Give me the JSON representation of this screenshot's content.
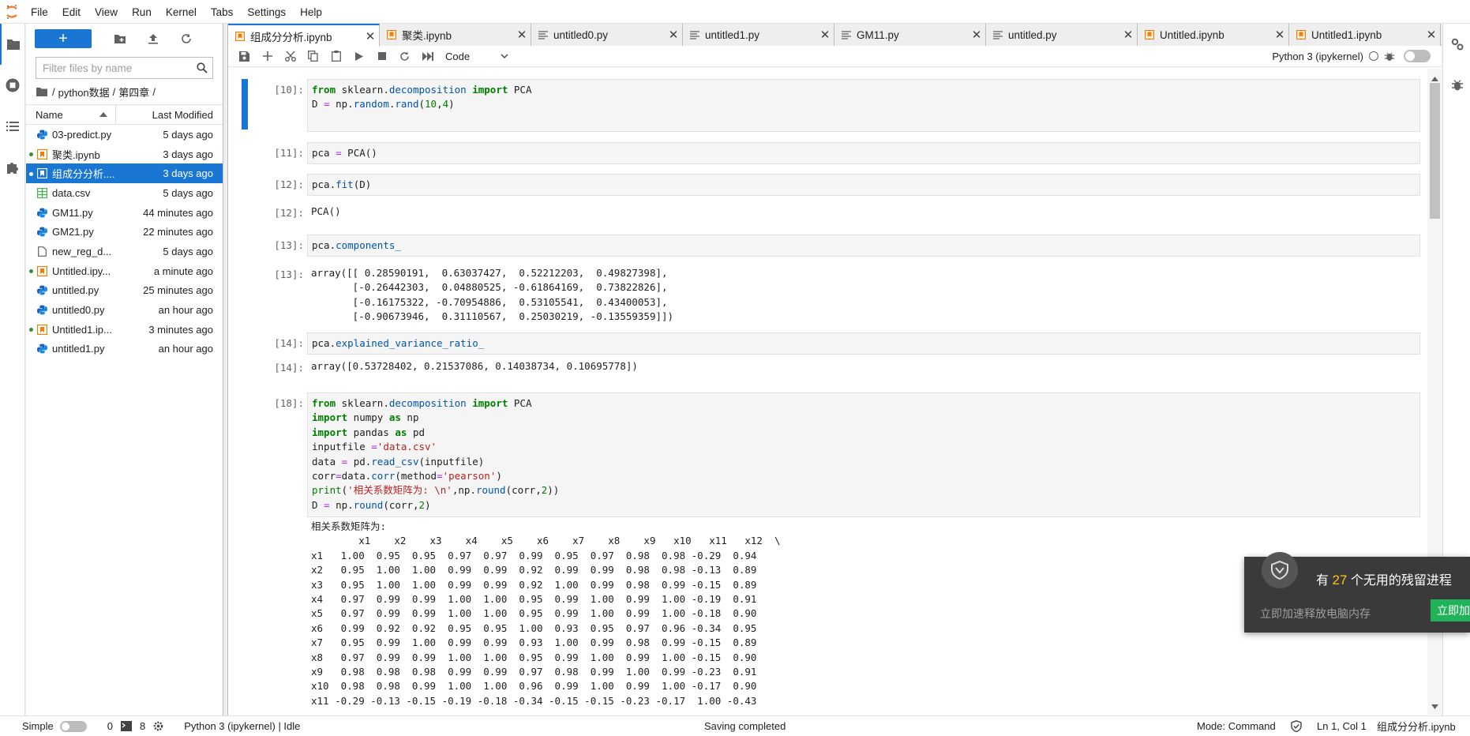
{
  "menubar": {
    "items": [
      "File",
      "Edit",
      "View",
      "Run",
      "Kernel",
      "Tabs",
      "Settings",
      "Help"
    ]
  },
  "filebrowser": {
    "filter_placeholder": "Filter files by name",
    "breadcrumb": [
      "/",
      "python数据",
      "/",
      "第四章",
      "/"
    ],
    "col_name": "Name",
    "col_modified": "Last Modified",
    "files": [
      {
        "name": "03-predict.py",
        "modified": "5 days ago",
        "type": "python",
        "running": false,
        "selected": false
      },
      {
        "name": "聚类.ipynb",
        "modified": "3 days ago",
        "type": "notebook",
        "running": true,
        "selected": false
      },
      {
        "name": "组成分分析....",
        "modified": "3 days ago",
        "type": "notebook",
        "running": true,
        "selected": true
      },
      {
        "name": "data.csv",
        "modified": "5 days ago",
        "type": "csv",
        "running": false,
        "selected": false
      },
      {
        "name": "GM11.py",
        "modified": "44 minutes ago",
        "type": "python",
        "running": false,
        "selected": false
      },
      {
        "name": "GM21.py",
        "modified": "22 minutes ago",
        "type": "python",
        "running": false,
        "selected": false
      },
      {
        "name": "new_reg_d...",
        "modified": "5 days ago",
        "type": "file",
        "running": false,
        "selected": false
      },
      {
        "name": "Untitled.ipy...",
        "modified": "a minute ago",
        "type": "notebook",
        "running": true,
        "selected": false
      },
      {
        "name": "untitled.py",
        "modified": "25 minutes ago",
        "type": "python",
        "running": false,
        "selected": false
      },
      {
        "name": "untitled0.py",
        "modified": "an hour ago",
        "type": "python",
        "running": false,
        "selected": false
      },
      {
        "name": "Untitled1.ip...",
        "modified": "3 minutes ago",
        "type": "notebook",
        "running": true,
        "selected": false
      },
      {
        "name": "untitled1.py",
        "modified": "an hour ago",
        "type": "python",
        "running": false,
        "selected": false
      }
    ]
  },
  "tabs": [
    {
      "label": "组成分分析.ipynb",
      "type": "notebook",
      "active": true
    },
    {
      "label": "聚类.ipynb",
      "type": "notebook",
      "active": false
    },
    {
      "label": "untitled0.py",
      "type": "text",
      "active": false
    },
    {
      "label": "untitled1.py",
      "type": "text",
      "active": false
    },
    {
      "label": "GM11.py",
      "type": "text",
      "active": false
    },
    {
      "label": "untitled.py",
      "type": "text",
      "active": false
    },
    {
      "label": "Untitled.ipynb",
      "type": "notebook",
      "active": false
    },
    {
      "label": "Untitled1.ipynb",
      "type": "notebook",
      "active": false
    }
  ],
  "toolbar": {
    "cell_type": "Code",
    "kernel_name": "Python 3 (ipykernel)"
  },
  "cells": {
    "c10": {
      "in": "[10]:"
    },
    "c11": {
      "in": "[11]:"
    },
    "c12": {
      "in": "[12]:",
      "out": "[12]:",
      "out_text": "PCA()"
    },
    "c13": {
      "in": "[13]:",
      "out": "[13]:"
    },
    "c14": {
      "in": "[14]:",
      "out": "[14]:",
      "out_text": "array([0.53728402, 0.21537086, 0.14038734, 0.10695778])"
    },
    "c18": {
      "in": "[18]:"
    }
  },
  "output13": [
    "array([[ 0.28590191,  0.63037427,  0.52212203,  0.49827398],",
    "       [-0.26442303,  0.04880525, -0.61864169,  0.73822826],",
    "       [-0.16175322, -0.70954886,  0.53105541,  0.43400053],",
    "       [-0.90673946,  0.31110567,  0.25030219, -0.13559359]])"
  ],
  "output18_title": "相关系数矩阵为:",
  "output18": [
    "        x1    x2    x3    x4    x5    x6    x7    x8    x9   x10   x11   x12  \\",
    "x1   1.00  0.95  0.95  0.97  0.97  0.99  0.95  0.97  0.98  0.98 -0.29  0.94",
    "x2   0.95  1.00  1.00  0.99  0.99  0.92  0.99  0.99  0.98  0.98 -0.13  0.89",
    "x3   0.95  1.00  1.00  0.99  0.99  0.92  1.00  0.99  0.98  0.99 -0.15  0.89",
    "x4   0.97  0.99  0.99  1.00  1.00  0.95  0.99  1.00  0.99  1.00 -0.19  0.91",
    "x5   0.97  0.99  0.99  1.00  1.00  0.95  0.99  1.00  0.99  1.00 -0.18  0.90",
    "x6   0.99  0.92  0.92  0.95  0.95  1.00  0.93  0.95  0.97  0.96 -0.34  0.95",
    "x7   0.95  0.99  1.00  0.99  0.99  0.93  1.00  0.99  0.98  0.99 -0.15  0.89",
    "x8   0.97  0.99  0.99  1.00  1.00  0.95  0.99  1.00  0.99  1.00 -0.15  0.90",
    "x9   0.98  0.98  0.98  0.99  0.99  0.97  0.98  0.99  1.00  0.99 -0.23  0.91",
    "x10  0.98  0.98  0.99  1.00  1.00  0.96  0.99  1.00  0.99  1.00 -0.17  0.90",
    "x11 -0.29 -0.13 -0.15 -0.19 -0.18 -0.34 -0.15 -0.15 -0.23 -0.17  1.00 -0.43"
  ],
  "statusbar": {
    "mode_label": "Simple",
    "terminals": "0",
    "kernels": "8",
    "kernel_status": "Python 3 (ipykernel) | Idle",
    "message": "Saving completed",
    "mode": "Mode: Command",
    "position": "Ln 1, Col 1",
    "filename": "组成分分析.ipynb"
  },
  "popup": {
    "title_prefix": "有",
    "count": "27",
    "title_suffix": "个无用的残留进程",
    "subtitle": "立即加速释放电脑内存",
    "button": "立即加"
  },
  "colors": {
    "accent": "#1976d2",
    "notebook_icon": "#f57c00",
    "python_icon": "#1565c0",
    "csv_icon": "#4caf50",
    "popup_button": "#21b35a",
    "popup_count": "#f5c518"
  }
}
